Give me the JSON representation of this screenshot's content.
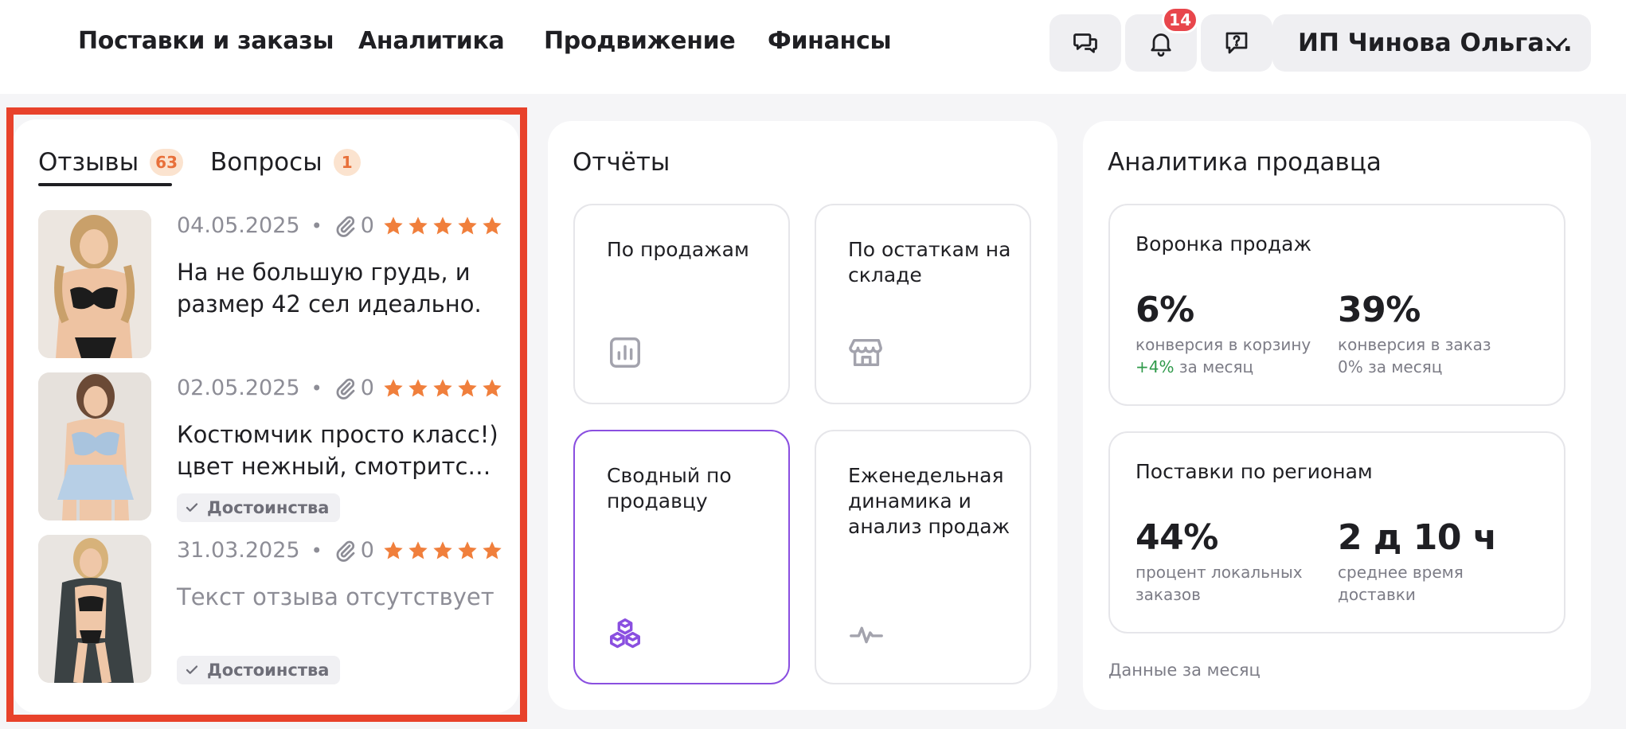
{
  "nav": {
    "items": [
      "Поставки и заказы",
      "Аналитика",
      "Продвижение",
      "Финансы"
    ]
  },
  "header": {
    "notifications_count": "14",
    "account_name": "ИП Чинова Ольга..."
  },
  "reviews_panel": {
    "tabs": [
      {
        "label": "Отзывы",
        "count": "63"
      },
      {
        "label": "Вопросы",
        "count": "1"
      }
    ],
    "items": [
      {
        "date": "04.05.2025",
        "separator": "•",
        "attachments": "0",
        "rating": 5,
        "text": "На не большую грудь, и размер 42 сел идеально.",
        "tag": ""
      },
      {
        "date": "02.05.2025",
        "separator": "•",
        "attachments": "0",
        "rating": 5,
        "text": "Костюмчик просто класс!) цвет нежный, смотрится очень красиво",
        "tag": "Достоинства"
      },
      {
        "date": "31.03.2025",
        "separator": "•",
        "attachments": "0",
        "rating": 5,
        "text": "Текст отзыва отсутствует",
        "tag": "Достоинства"
      }
    ]
  },
  "reports": {
    "title": "Отчёты",
    "cards": [
      {
        "label": "По продажам",
        "icon": "bar-chart-icon"
      },
      {
        "label": "По остаткам на складе",
        "icon": "store-icon"
      },
      {
        "label": "Сводный по продавцу",
        "icon": "cubes-icon"
      },
      {
        "label": "Еженедельная динамика и анализ продаж",
        "icon": "pulse-icon"
      }
    ]
  },
  "analytics": {
    "title": "Аналитика продавца",
    "funnel": {
      "title": "Воронка продаж",
      "metrics": [
        {
          "value": "6%",
          "label": "конверсия в корзину",
          "delta": "+4%",
          "period": "за месяц"
        },
        {
          "value": "39%",
          "label": "конверсия в заказ",
          "delta": "0%",
          "period": "за месяц"
        }
      ]
    },
    "regions": {
      "title": "Поставки по регионам",
      "metrics": [
        {
          "value": "44%",
          "label": "процент локальных заказов"
        },
        {
          "value": "2 д 10 ч",
          "label": "среднее время доставки"
        }
      ]
    },
    "footnote": "Данные за месяц"
  },
  "colors": {
    "accent_purple": "#8a4fe0",
    "star_orange": "#f07f3c",
    "badge_red": "#e8464c",
    "highlight_frame": "#e8422b",
    "positive_green": "#2f9a4a"
  }
}
